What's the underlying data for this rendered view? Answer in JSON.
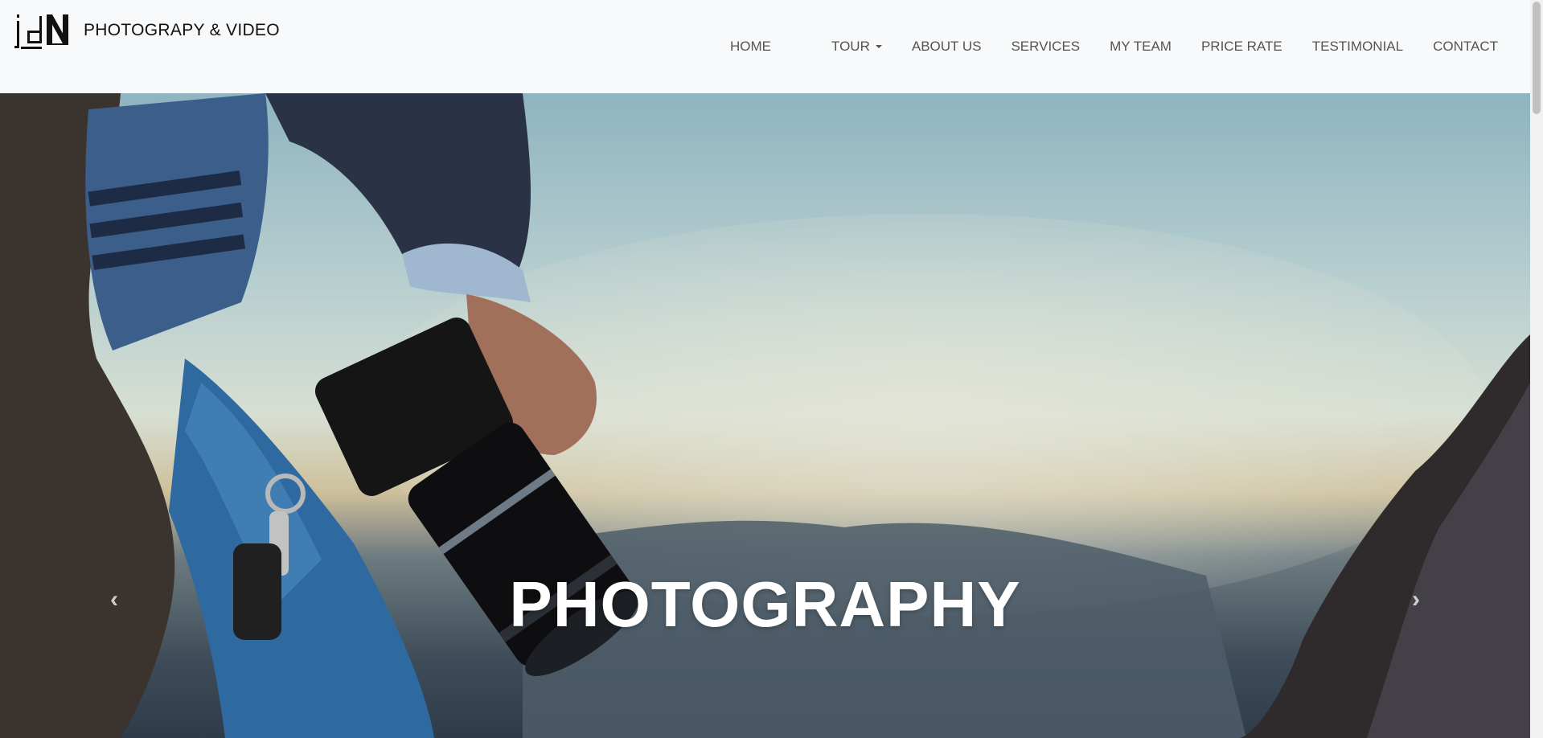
{
  "brand": {
    "logo_text": "jdN",
    "name": "PHOTOGRAPY & VIDEO"
  },
  "nav": {
    "items": [
      {
        "label": "HOME",
        "has_dropdown": false
      },
      {
        "label": "TOUR",
        "has_dropdown": true
      },
      {
        "label": "ABOUT US",
        "has_dropdown": false
      },
      {
        "label": "SERVICES",
        "has_dropdown": false
      },
      {
        "label": "MY TEAM",
        "has_dropdown": false
      },
      {
        "label": "PRICE RATE",
        "has_dropdown": false
      },
      {
        "label": "TESTIMONIAL",
        "has_dropdown": false
      },
      {
        "label": "CONTACT",
        "has_dropdown": false
      }
    ]
  },
  "hero": {
    "caption": "PHOTOGRAPHY",
    "prev_icon": "chevron-left-icon",
    "next_icon": "chevron-right-icon"
  },
  "colors": {
    "navbar_bg": "#f8f9fa",
    "nav_text": "#555555",
    "brand_text": "#111111",
    "caption_text": "#ffffff"
  }
}
